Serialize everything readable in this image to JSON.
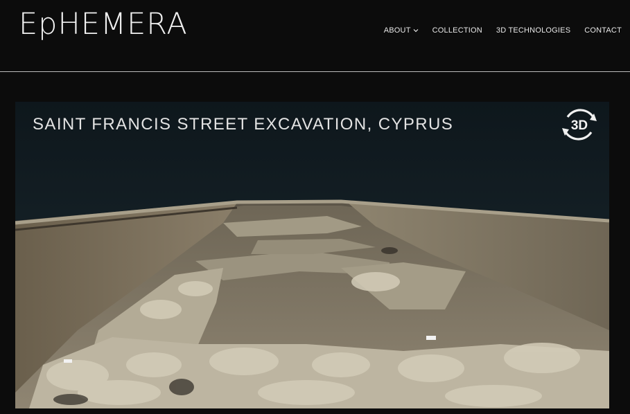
{
  "brand": {
    "logo_text": "EpHEMERA"
  },
  "nav": {
    "items": [
      {
        "label": "ABOUT",
        "has_dropdown": true,
        "icon": "chevron-down-icon"
      },
      {
        "label": "COLLECTION"
      },
      {
        "label": "3D TECHNOLOGIES"
      },
      {
        "label": "CONTACT"
      }
    ]
  },
  "hero": {
    "title": "SAINT FRANCIS STREET EXCAVATION, CYPRUS",
    "badge_label": "3D",
    "badge_icon": "3d-rotate-icon"
  },
  "colors": {
    "background": "#0c0c0c",
    "text": "#e6e6e6",
    "divider": "#bdbdbd"
  }
}
